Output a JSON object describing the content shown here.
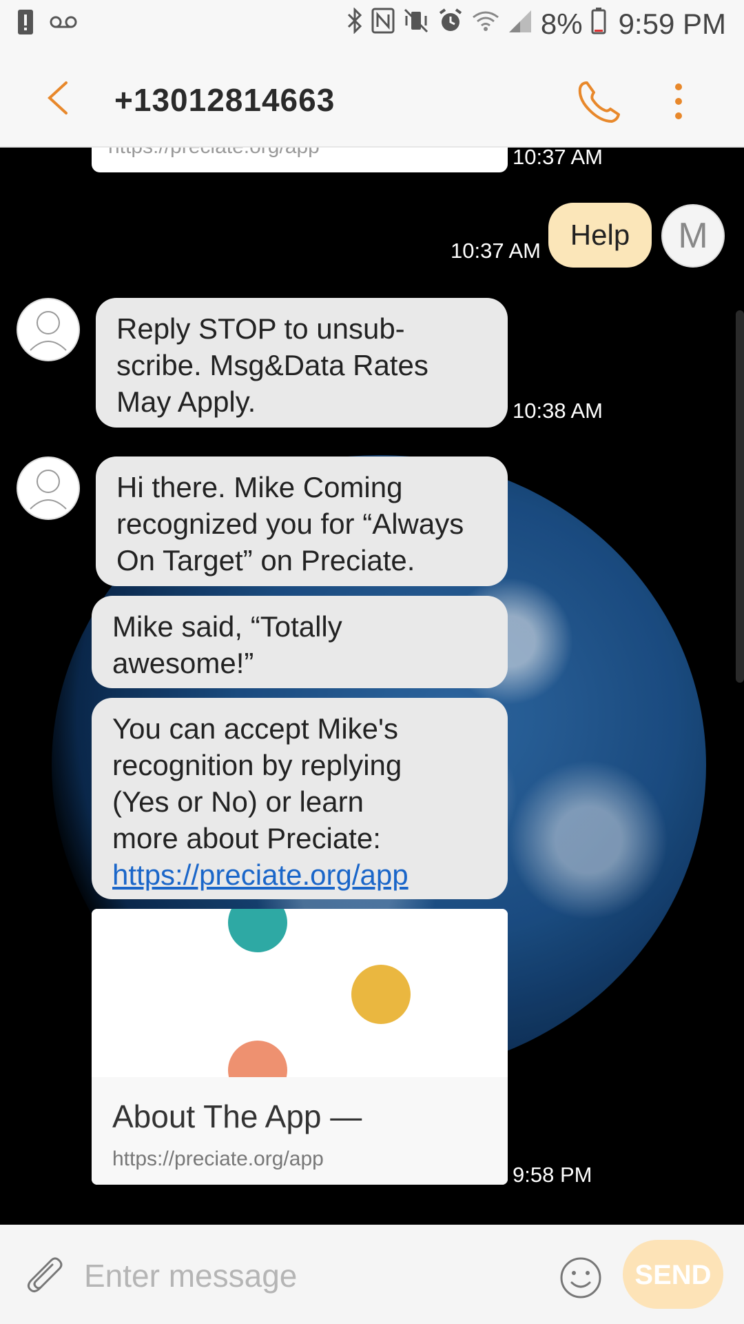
{
  "status_bar": {
    "battery_percent": "8%",
    "clock": "9:59 PM"
  },
  "header": {
    "contact": "+13012814663"
  },
  "messages": {
    "prev_link_text": "https://preciate.org/app",
    "prev_time": "10:37 AM",
    "help_time": "10:37 AM",
    "help_text": "Help",
    "user_avatar_initial": "M",
    "stop_line1": "Reply STOP to unsub-",
    "stop_line2": "scribe. Msg&Data Rates",
    "stop_line3": "May Apply.",
    "stop_time": "10:38 AM",
    "hi_line1": "Hi there. Mike Coming",
    "hi_line2": "recognized you for “Always",
    "hi_line3": "On Target” on Preciate.",
    "said_line1": "Mike said, “Totally",
    "said_line2": "awesome!”",
    "accept_line1": "You can accept Mike's",
    "accept_line2": "recognition by replying",
    "accept_line3": "(Yes or No) or learn",
    "accept_line4": "more about Preciate:",
    "accept_link": "https://preciate.org/app",
    "card_title": "About The App —",
    "card_url": "https://preciate.org/app",
    "last_time": "9:58 PM"
  },
  "input": {
    "placeholder": "Enter message",
    "send_label": "SEND"
  },
  "colors": {
    "accent": "#e8882b",
    "incoming_bubble": "#e9e9e9",
    "outgoing_bubble": "#fbe6b9",
    "dot_teal": "#2ea9a4",
    "dot_yellow": "#eab740",
    "dot_salmon": "#ee9170"
  }
}
